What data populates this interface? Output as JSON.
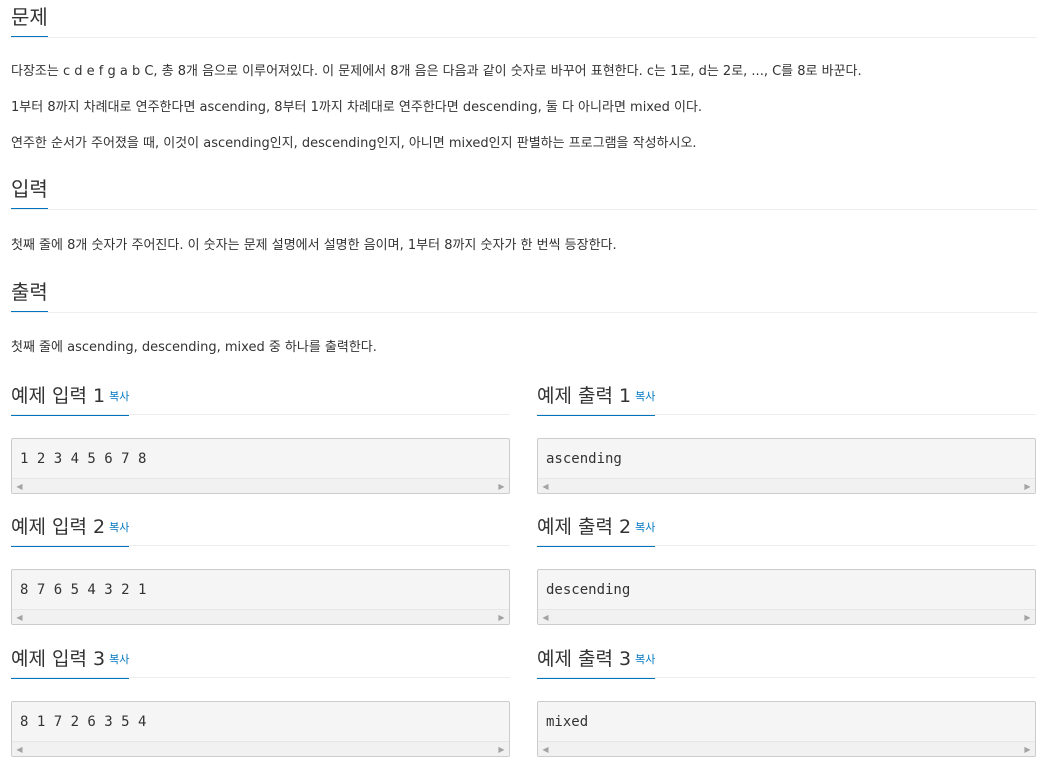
{
  "problem": {
    "title": "문제",
    "paragraphs": [
      "다장조는 c d e f g a b C, 총 8개 음으로 이루어져있다. 이 문제에서 8개 음은 다음과 같이 숫자로 바꾸어 표현한다. c는 1로, d는 2로, ..., C를 8로 바꾼다.",
      "1부터 8까지 차례대로 연주한다면 ascending, 8부터 1까지 차례대로 연주한다면 descending, 둘 다 아니라면 mixed 이다.",
      "연주한 순서가 주어졌을 때, 이것이 ascending인지, descending인지, 아니면 mixed인지 판별하는 프로그램을 작성하시오."
    ]
  },
  "input": {
    "title": "입력",
    "paragraph": "첫째 줄에 8개 숫자가 주어진다. 이 숫자는 문제 설명에서 설명한 음이며, 1부터 8까지 숫자가 한 번씩 등장한다."
  },
  "output": {
    "title": "출력",
    "paragraph": "첫째 줄에 ascending, descending, mixed 중 하나를 출력한다."
  },
  "copy_label": "복사",
  "samples": [
    {
      "input_title": "예제 입력 1",
      "input_value": "1 2 3 4 5 6 7 8",
      "output_title": "예제 출력 1",
      "output_value": "ascending"
    },
    {
      "input_title": "예제 입력 2",
      "input_value": "8 7 6 5 4 3 2 1",
      "output_title": "예제 출력 2",
      "output_value": "descending"
    },
    {
      "input_title": "예제 입력 3",
      "input_value": "8 1 7 2 6 3 5 4",
      "output_title": "예제 출력 3",
      "output_value": "mixed"
    }
  ],
  "icons": {
    "scroll_left": "scroll-left-arrow-icon",
    "scroll_right": "scroll-right-arrow-icon"
  },
  "colors": {
    "accent": "#0076c0",
    "text": "#333333",
    "pre_background": "#f5f5f5"
  }
}
